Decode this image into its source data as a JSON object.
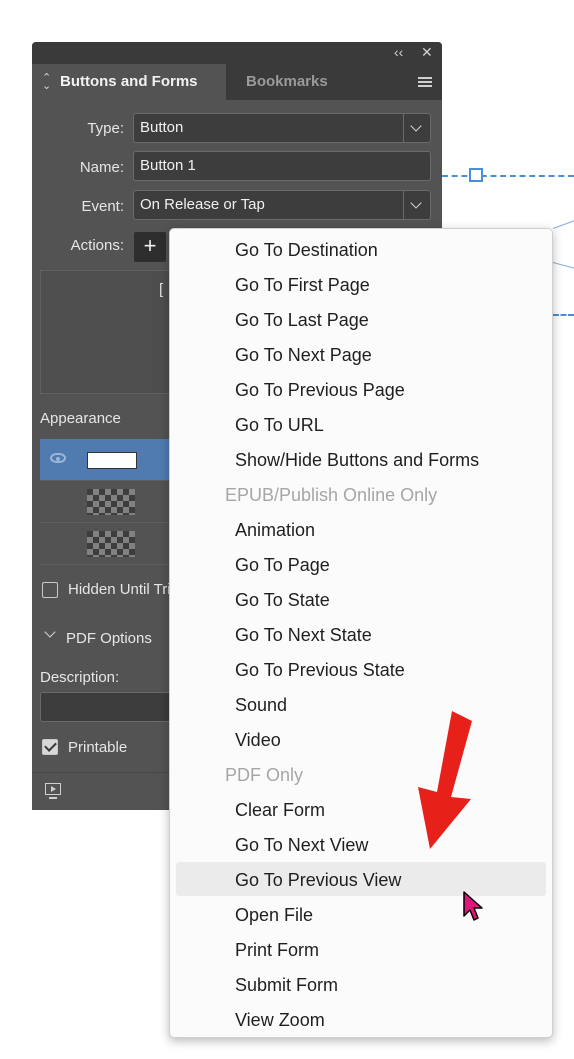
{
  "panel": {
    "tabs": {
      "active": "Buttons and Forms",
      "inactive": "Bookmarks"
    },
    "type": {
      "label": "Type:",
      "value": "Button"
    },
    "name": {
      "label": "Name:",
      "value": "Button 1"
    },
    "event": {
      "label": "Event:",
      "value": "On Release or Tap"
    },
    "actions": {
      "label": "Actions:",
      "add": "+",
      "list_text": "["
    },
    "appearance": {
      "label": "Appearance"
    },
    "hidden_until": {
      "label": "Hidden Until Tri",
      "checked": false
    },
    "pdf_options": {
      "label": "PDF Options"
    },
    "description": {
      "label": "Description:"
    },
    "printable": {
      "label": "Printable",
      "checked": true
    }
  },
  "menu": {
    "items": [
      {
        "label": "Go To Destination",
        "kind": "item"
      },
      {
        "label": "Go To First Page",
        "kind": "item"
      },
      {
        "label": "Go To Last Page",
        "kind": "item"
      },
      {
        "label": "Go To Next Page",
        "kind": "item"
      },
      {
        "label": "Go To Previous Page",
        "kind": "item"
      },
      {
        "label": "Go To URL",
        "kind": "item"
      },
      {
        "label": "Show/Hide Buttons and Forms",
        "kind": "item"
      },
      {
        "label": "EPUB/Publish Online Only",
        "kind": "header"
      },
      {
        "label": "Animation",
        "kind": "item"
      },
      {
        "label": "Go To Page",
        "kind": "item"
      },
      {
        "label": "Go To State",
        "kind": "item"
      },
      {
        "label": "Go To Next State",
        "kind": "item"
      },
      {
        "label": "Go To Previous State",
        "kind": "item"
      },
      {
        "label": "Sound",
        "kind": "item"
      },
      {
        "label": "Video",
        "kind": "item"
      },
      {
        "label": "PDF Only",
        "kind": "header"
      },
      {
        "label": "Clear Form",
        "kind": "item"
      },
      {
        "label": "Go To Next View",
        "kind": "item"
      },
      {
        "label": "Go To Previous View",
        "kind": "item",
        "hovered": true
      },
      {
        "label": "Open File",
        "kind": "item"
      },
      {
        "label": "Print Form",
        "kind": "item"
      },
      {
        "label": "Submit Form",
        "kind": "item"
      },
      {
        "label": "View Zoom",
        "kind": "item"
      }
    ]
  },
  "colors": {
    "panel": "#535353",
    "selected_row": "#4f7bb0",
    "arrow": "#e8201a",
    "cursor": "#e0147a",
    "guide": "#4a90d9"
  },
  "icons": [
    "collapse-icon",
    "close-icon",
    "panel-menu-icon",
    "dropdown-chevron-icon",
    "plus-icon",
    "eye-icon",
    "chevron-down-icon",
    "checkbox-icon",
    "preview-icon",
    "red-arrow-annotation",
    "mouse-cursor-icon"
  ]
}
